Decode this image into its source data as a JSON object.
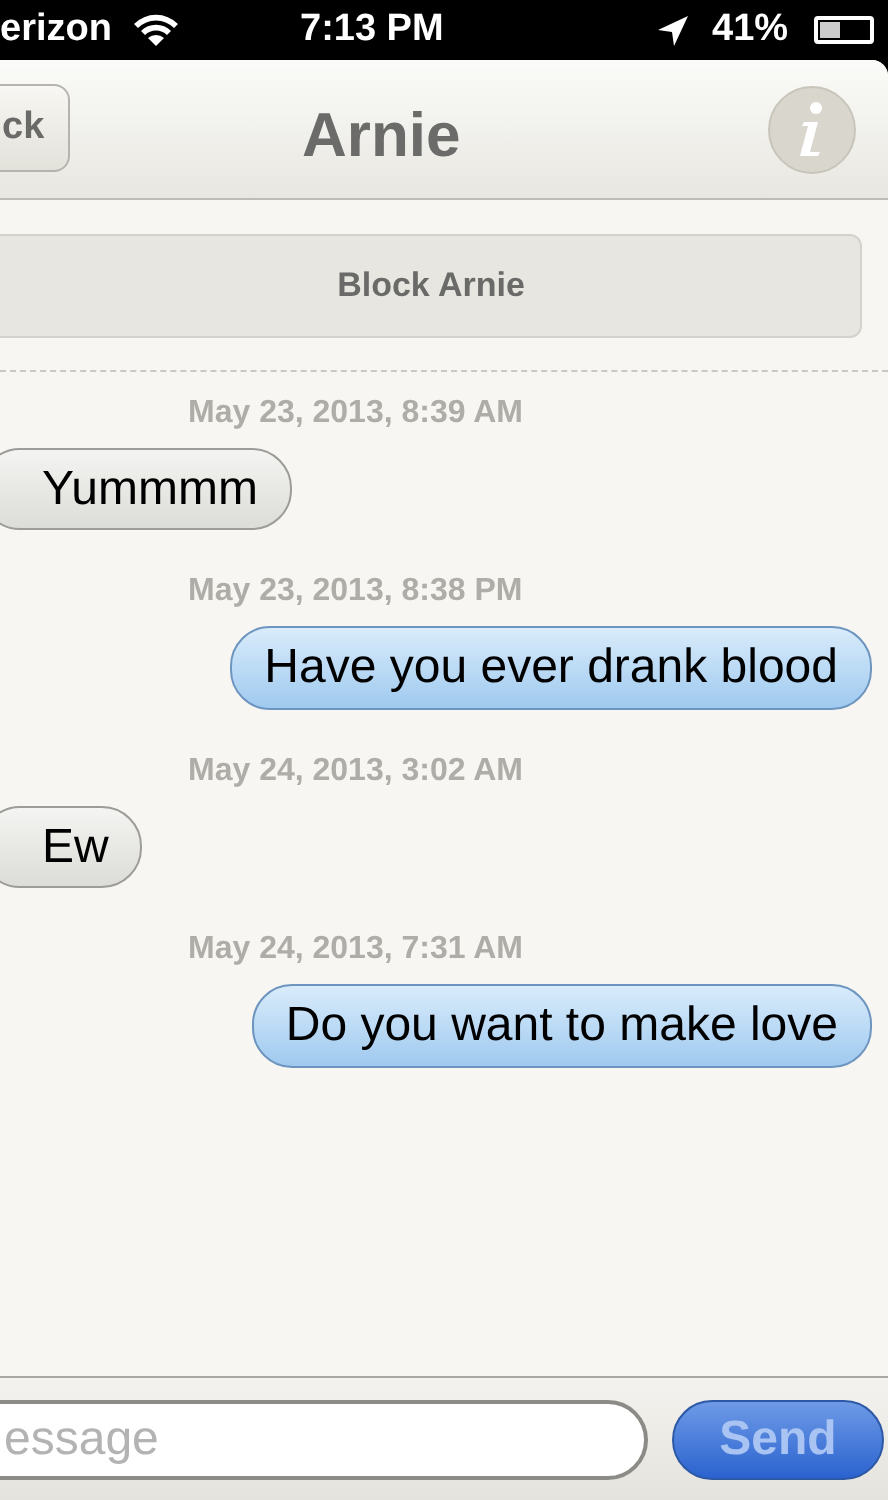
{
  "status_bar": {
    "carrier": "erizon",
    "time": "7:13 PM",
    "battery_text": "41%"
  },
  "nav": {
    "back": "ck",
    "title": "Arnie"
  },
  "block_button": "Block Arnie",
  "messages": [
    {
      "kind": "timestamp",
      "text": "May 23, 2013, 8:39 AM"
    },
    {
      "kind": "incoming",
      "text": "Yummmm"
    },
    {
      "kind": "timestamp",
      "text": "May 23, 2013, 8:38 PM"
    },
    {
      "kind": "outgoing",
      "text": "Have you ever drank blood"
    },
    {
      "kind": "timestamp",
      "text": "May 24, 2013, 3:02 AM"
    },
    {
      "kind": "incoming",
      "text": "Ew"
    },
    {
      "kind": "timestamp",
      "text": "May 24, 2013, 7:31 AM"
    },
    {
      "kind": "outgoing",
      "text": "Do you want to make love"
    }
  ],
  "composer": {
    "placeholder": "essage",
    "send": "Send"
  }
}
